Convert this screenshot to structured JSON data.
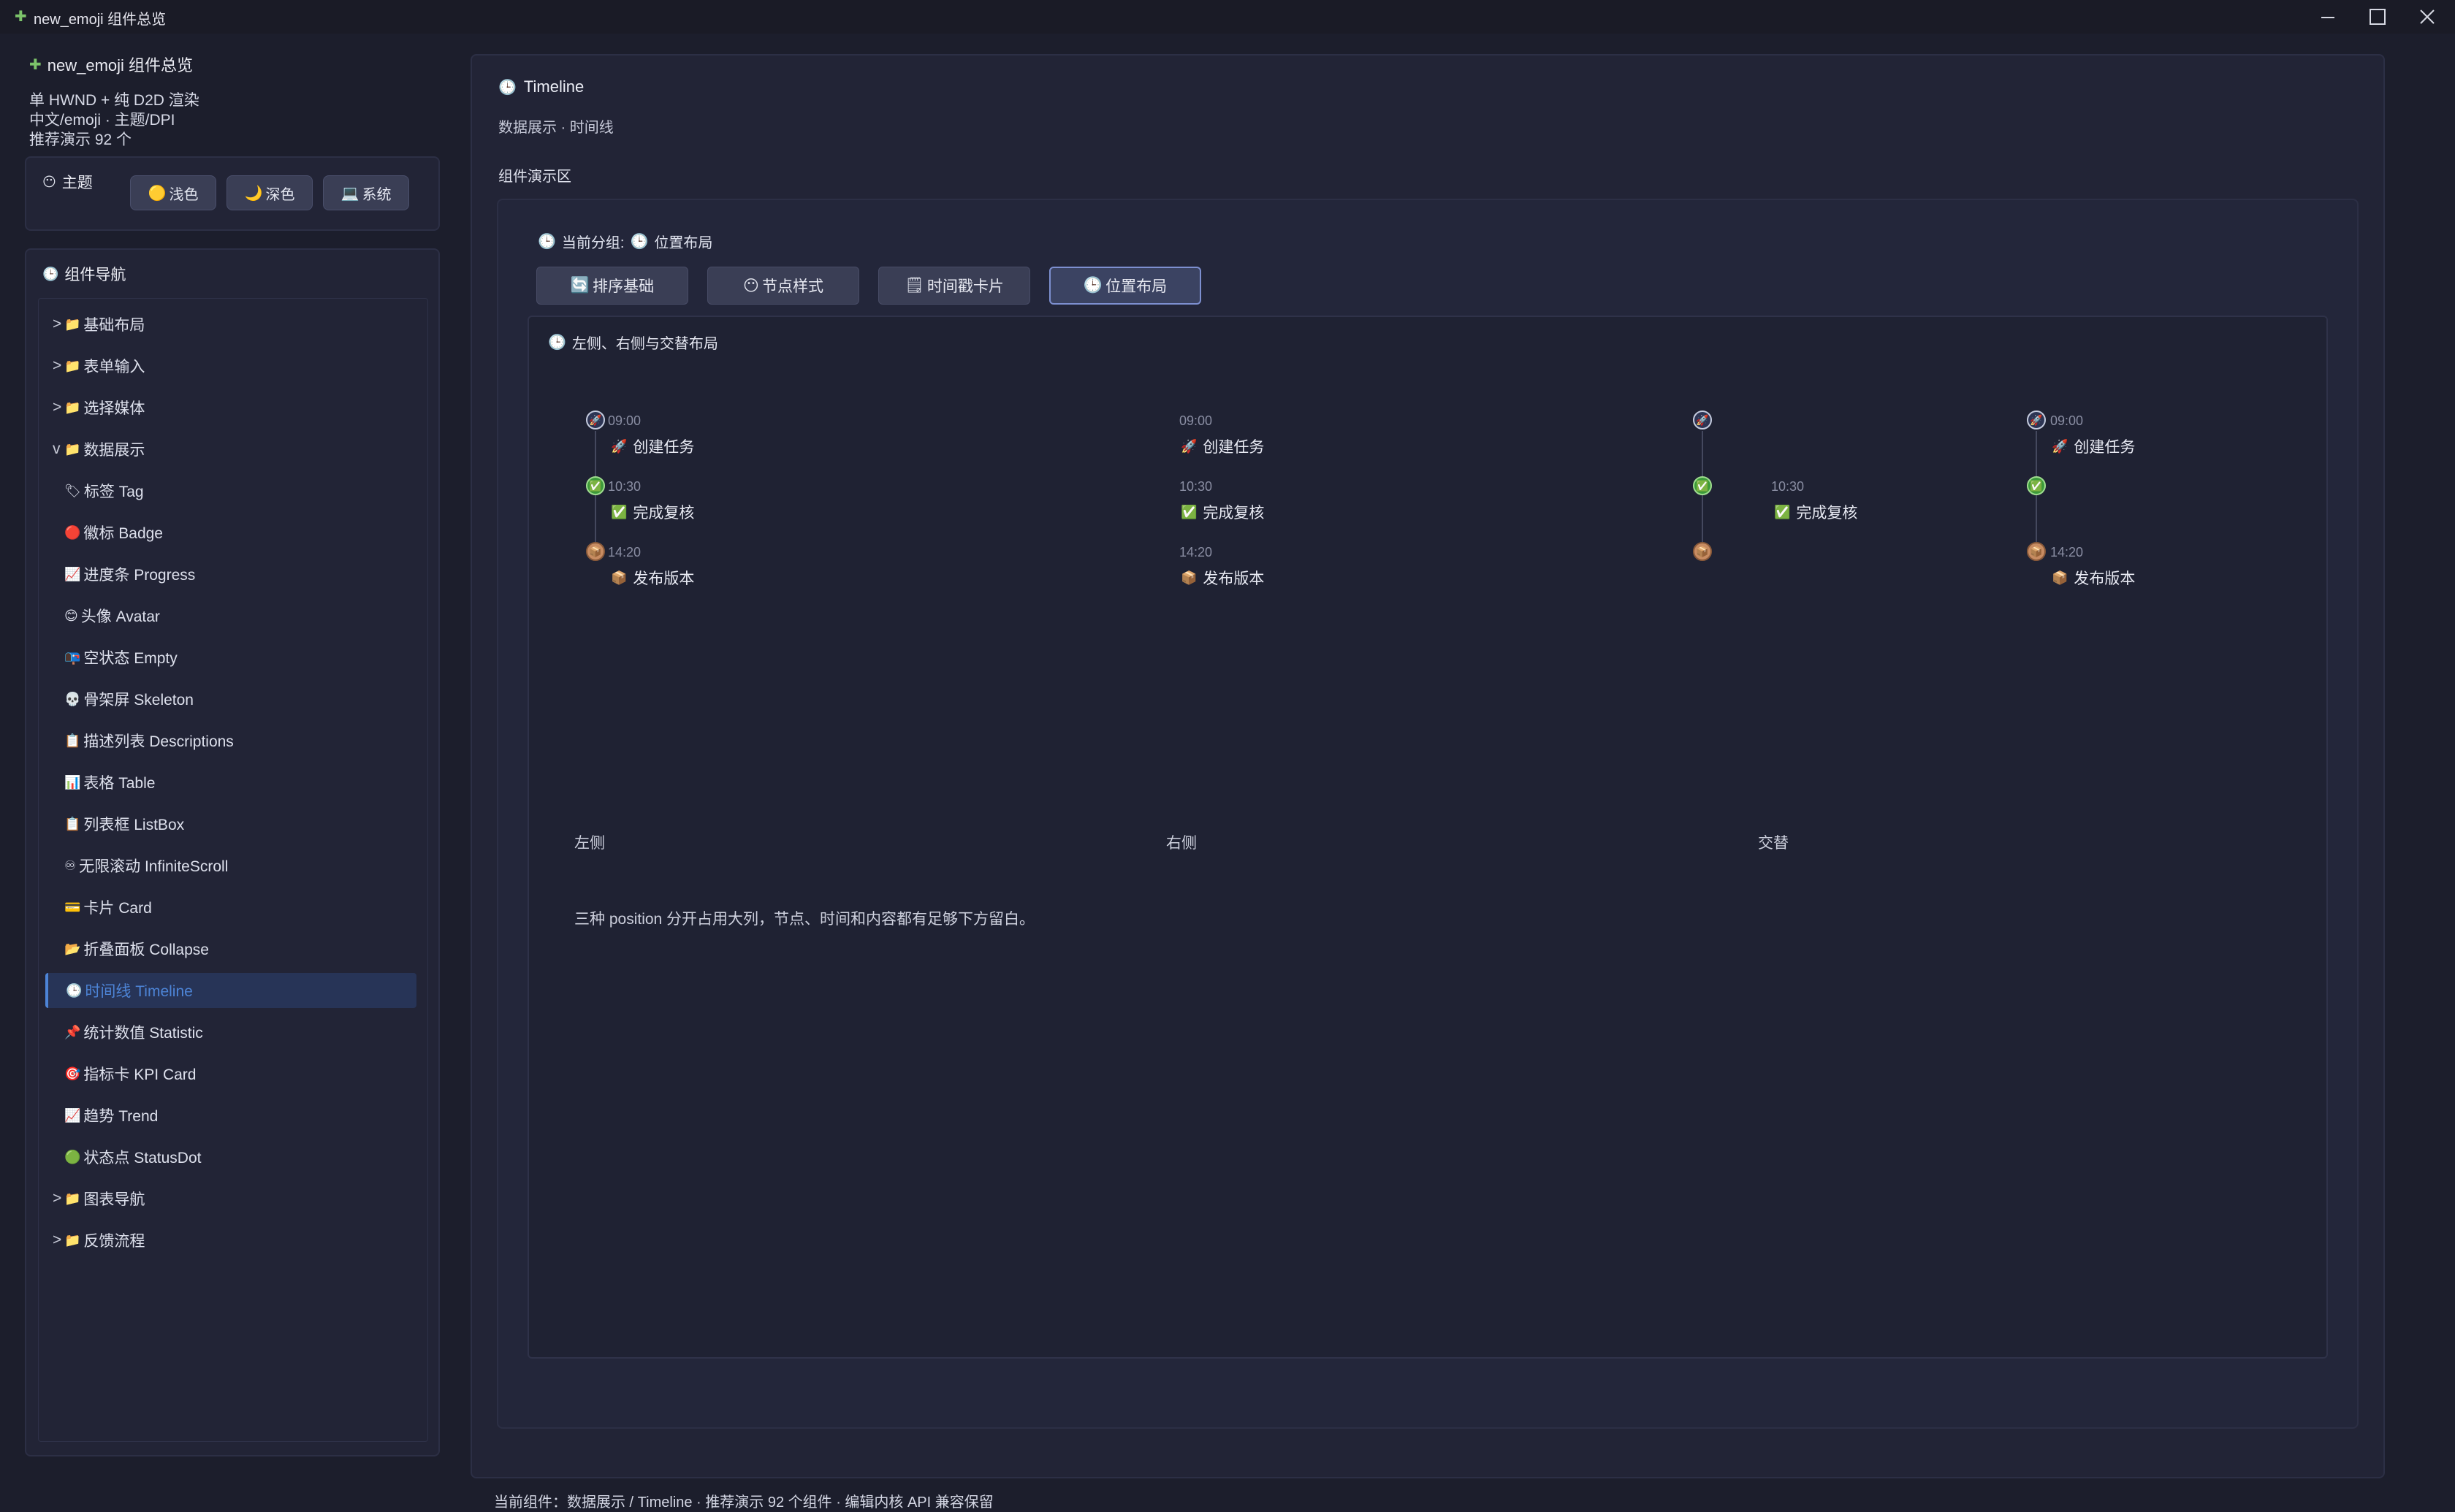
{
  "window": {
    "title": "new_emoji 组件总览",
    "app_icon": "puzzle-icon"
  },
  "sidebar": {
    "header": "new_emoji 组件总览",
    "info_lines": [
      "单 HWND + 纯 D2D 渲染",
      "中文/emoji · 主题/DPI",
      "推荐演示 92 个"
    ],
    "theme": {
      "label": "主题",
      "buttons": [
        {
          "icon": "🟡",
          "label": "浅色"
        },
        {
          "icon": "🌙",
          "label": "深色"
        },
        {
          "icon": "💻",
          "label": "系统"
        }
      ]
    },
    "nav_title": "组件导航",
    "nav": [
      {
        "arrow": ">",
        "icon": "📁",
        "label": "基础布局"
      },
      {
        "arrow": ">",
        "icon": "📁",
        "label": "表单输入"
      },
      {
        "arrow": ">",
        "icon": "📁",
        "label": "选择媒体"
      },
      {
        "arrow": "v",
        "icon": "📁",
        "label": "数据展示"
      },
      {
        "icon": "🏷",
        "label": "标签 Tag"
      },
      {
        "icon": "🔴",
        "label": "徽标 Badge"
      },
      {
        "icon": "📈",
        "label": "进度条 Progress"
      },
      {
        "icon": "😊",
        "label": "头像 Avatar"
      },
      {
        "icon": "📭",
        "label": "空状态 Empty"
      },
      {
        "icon": "💀",
        "label": "骨架屏 Skeleton"
      },
      {
        "icon": "📋",
        "label": "描述列表 Descriptions"
      },
      {
        "icon": "📊",
        "label": "表格 Table"
      },
      {
        "icon": "📋",
        "label": "列表框 ListBox"
      },
      {
        "icon": "♾",
        "label": "无限滚动 InfiniteScroll"
      },
      {
        "icon": "💳",
        "label": "卡片 Card"
      },
      {
        "icon": "📂",
        "label": "折叠面板 Collapse"
      },
      {
        "icon": "🕒",
        "label": "时间线 Timeline"
      },
      {
        "icon": "📌",
        "label": "统计数值 Statistic"
      },
      {
        "icon": "🎯",
        "label": "指标卡 KPI Card"
      },
      {
        "icon": "📈",
        "label": "趋势 Trend"
      },
      {
        "icon": "🟢",
        "label": "状态点 StatusDot"
      },
      {
        "arrow": ">",
        "icon": "📁",
        "label": "图表导航"
      },
      {
        "arrow": ">",
        "icon": "📁",
        "label": "反馈流程"
      }
    ]
  },
  "main": {
    "title": "Timeline",
    "subtitle": "数据展示 · 时间线",
    "demo_area_label": "组件演示区",
    "current_group_label": "当前分组:",
    "current_group_value": "位置布局",
    "tabs": [
      {
        "icon": "🔄",
        "label": "排序基础"
      },
      {
        "icon": "😶",
        "label": "节点样式"
      },
      {
        "icon": "🗒",
        "label": "时间戳卡片"
      },
      {
        "icon": "🕒",
        "label": "位置布局"
      }
    ],
    "section_title": "左侧、右侧与交替布局",
    "events": [
      {
        "time": "09:00",
        "icon": "🚀",
        "label": "创建任务"
      },
      {
        "time": "10:30",
        "icon": "✅",
        "label": "完成复核"
      },
      {
        "time": "14:20",
        "icon": "📦",
        "label": "发布版本"
      }
    ],
    "columns": [
      "左侧",
      "右侧",
      "交替"
    ],
    "description": "三种 position 分开占用大列，节点、时间和内容都有足够下方留白。"
  },
  "statusbar": "当前组件：数据展示 / Timeline · 推荐演示 92 个组件 · 编辑内核 API 兼容保留"
}
